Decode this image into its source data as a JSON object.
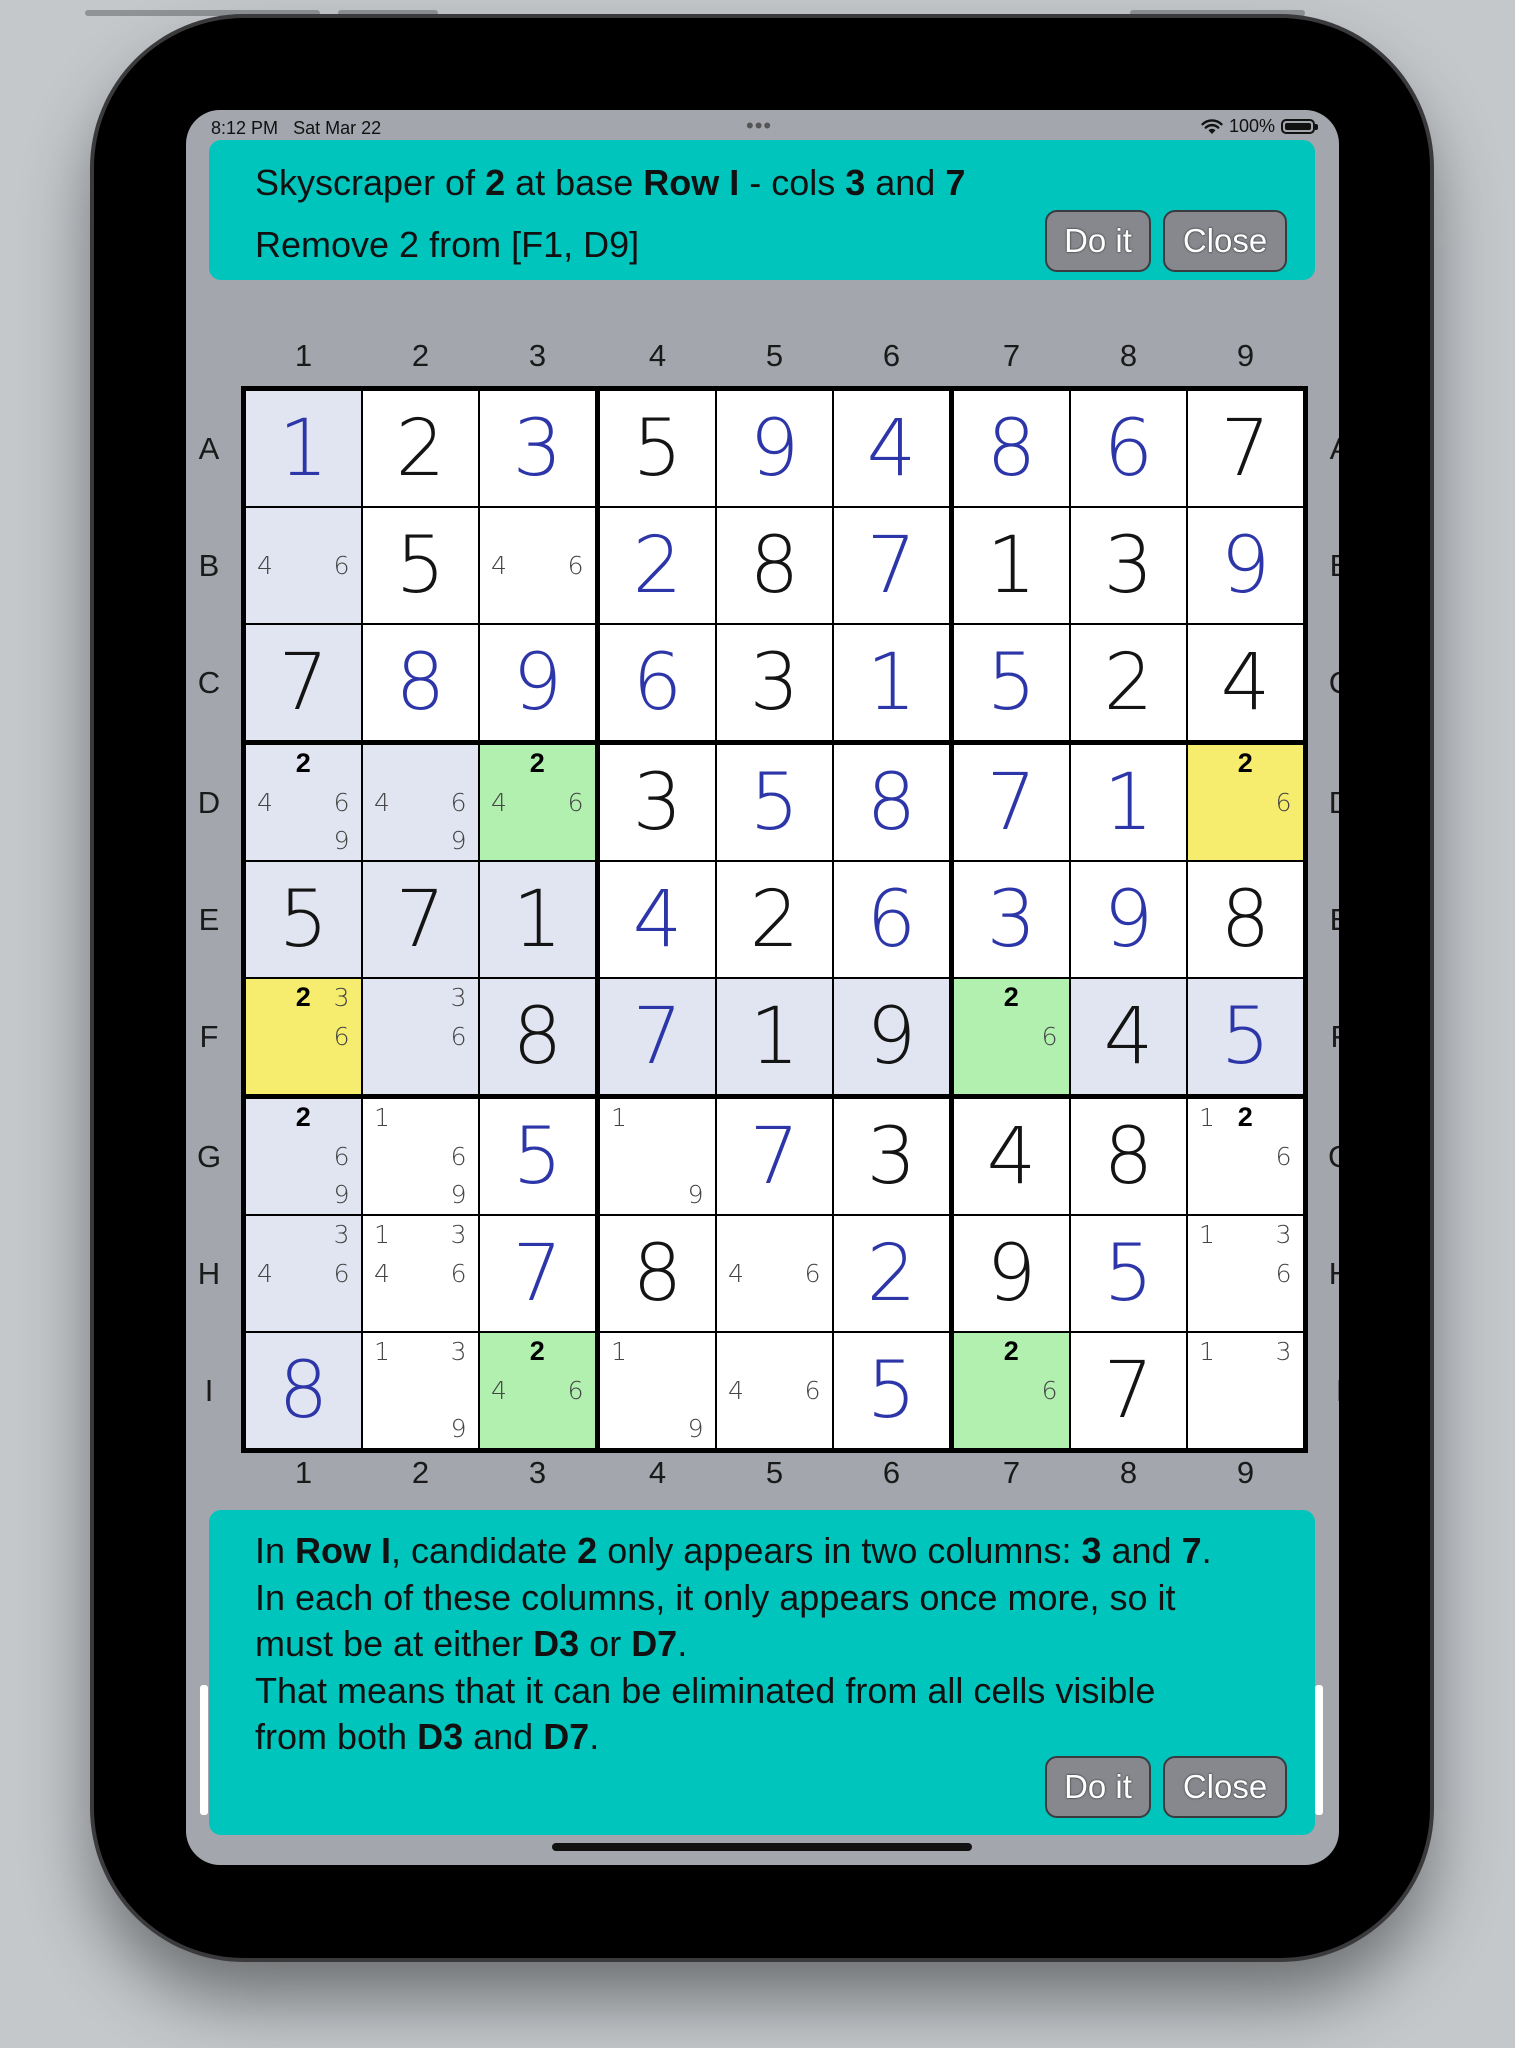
{
  "status_bar": {
    "time": "8:12 PM",
    "date": "Sat Mar 22",
    "battery": "100%"
  },
  "hint_top": {
    "line1": [
      {
        "t": "Skyscraper of ",
        "b": false
      },
      {
        "t": "2",
        "b": true
      },
      {
        "t": " at base ",
        "b": false
      },
      {
        "t": "Row I",
        "b": true
      },
      {
        "t": " - cols ",
        "b": false
      },
      {
        "t": "3",
        "b": true
      },
      {
        "t": " and ",
        "b": false
      },
      {
        "t": "7",
        "b": true
      }
    ],
    "line2": "Remove 2 from [F1, D9]",
    "do_label": "Do it",
    "close_label": "Close"
  },
  "hint_bottom": {
    "lines": [
      [
        {
          "t": "In ",
          "b": false
        },
        {
          "t": "Row I",
          "b": true
        },
        {
          "t": ", candidate ",
          "b": false
        },
        {
          "t": "2",
          "b": true
        },
        {
          "t": " only appears in two columns: ",
          "b": false
        },
        {
          "t": "3",
          "b": true
        },
        {
          "t": " and ",
          "b": false
        },
        {
          "t": "7",
          "b": true
        },
        {
          "t": ".",
          "b": false
        }
      ],
      [
        {
          "t": "In each of these columns, it only appears once more, so it",
          "b": false
        }
      ],
      [
        {
          "t": "must be at either ",
          "b": false
        },
        {
          "t": "D3",
          "b": true
        },
        {
          "t": " or ",
          "b": false
        },
        {
          "t": "D7",
          "b": true
        },
        {
          "t": ".",
          "b": false
        }
      ],
      [
        {
          "t": "That means that it can be eliminated from all cells visible",
          "b": false
        }
      ],
      [
        {
          "t": "from both ",
          "b": false
        },
        {
          "t": "D3",
          "b": true
        },
        {
          "t": " and ",
          "b": false
        },
        {
          "t": "D7",
          "b": true
        },
        {
          "t": ".",
          "b": false
        }
      ]
    ],
    "do_label": "Do it",
    "close_label": "Close"
  },
  "board": {
    "col_labels": [
      "1",
      "2",
      "3",
      "4",
      "5",
      "6",
      "7",
      "8",
      "9"
    ],
    "row_labels": [
      "A",
      "B",
      "C",
      "D",
      "E",
      "F",
      "G",
      "H",
      "I"
    ],
    "colors": {
      "given": "#141414",
      "user": "#2d36a8",
      "highlight": "#e1e5f1",
      "yellow": "#f6ec6e",
      "green": "#b2f0b0"
    },
    "cells": [
      [
        {
          "v": "1",
          "k": "u",
          "bg": "hl"
        },
        {
          "v": "2",
          "k": "g"
        },
        {
          "v": "3",
          "k": "u"
        },
        {
          "v": "5",
          "k": "g"
        },
        {
          "v": "9",
          "k": "u"
        },
        {
          "v": "4",
          "k": "u"
        },
        {
          "v": "8",
          "k": "u"
        },
        {
          "v": "6",
          "k": "u"
        },
        {
          "v": "7",
          "k": "g"
        }
      ],
      [
        {
          "c": [
            4,
            6
          ],
          "bg": "hl"
        },
        {
          "v": "5",
          "k": "g"
        },
        {
          "c": [
            4,
            6
          ]
        },
        {
          "v": "2",
          "k": "u"
        },
        {
          "v": "8",
          "k": "g"
        },
        {
          "v": "7",
          "k": "u"
        },
        {
          "v": "1",
          "k": "g"
        },
        {
          "v": "3",
          "k": "g"
        },
        {
          "v": "9",
          "k": "u"
        }
      ],
      [
        {
          "v": "7",
          "k": "g",
          "bg": "hl"
        },
        {
          "v": "8",
          "k": "u"
        },
        {
          "v": "9",
          "k": "u"
        },
        {
          "v": "6",
          "k": "u"
        },
        {
          "v": "3",
          "k": "g"
        },
        {
          "v": "1",
          "k": "u"
        },
        {
          "v": "5",
          "k": "u"
        },
        {
          "v": "2",
          "k": "g"
        },
        {
          "v": "4",
          "k": "g"
        }
      ],
      [
        {
          "c": [
            2,
            4,
            6,
            9
          ],
          "bg": "hl"
        },
        {
          "c": [
            4,
            6,
            9
          ],
          "bg": "hl"
        },
        {
          "c": [
            2,
            4,
            6
          ],
          "bg": "green"
        },
        {
          "v": "3",
          "k": "g"
        },
        {
          "v": "5",
          "k": "u"
        },
        {
          "v": "8",
          "k": "u"
        },
        {
          "v": "7",
          "k": "u"
        },
        {
          "v": "1",
          "k": "u"
        },
        {
          "c": [
            2,
            6
          ],
          "bg": "yellow"
        }
      ],
      [
        {
          "v": "5",
          "k": "g",
          "bg": "hl"
        },
        {
          "v": "7",
          "k": "g",
          "bg": "hl"
        },
        {
          "v": "1",
          "k": "g",
          "bg": "hl"
        },
        {
          "v": "4",
          "k": "u"
        },
        {
          "v": "2",
          "k": "g"
        },
        {
          "v": "6",
          "k": "u"
        },
        {
          "v": "3",
          "k": "u"
        },
        {
          "v": "9",
          "k": "u"
        },
        {
          "v": "8",
          "k": "g"
        }
      ],
      [
        {
          "c": [
            2,
            3,
            6
          ],
          "bg": "yellow"
        },
        {
          "c": [
            3,
            6
          ],
          "bg": "hl"
        },
        {
          "v": "8",
          "k": "g",
          "bg": "hl"
        },
        {
          "v": "7",
          "k": "u",
          "bg": "hl"
        },
        {
          "v": "1",
          "k": "g",
          "bg": "hl"
        },
        {
          "v": "9",
          "k": "g",
          "bg": "hl"
        },
        {
          "c": [
            2,
            6
          ],
          "bg": "green"
        },
        {
          "v": "4",
          "k": "g",
          "bg": "hl"
        },
        {
          "v": "5",
          "k": "u",
          "bg": "hl"
        }
      ],
      [
        {
          "c": [
            2,
            6,
            9
          ],
          "bg": "hl"
        },
        {
          "c": [
            1,
            6,
            9
          ]
        },
        {
          "v": "5",
          "k": "u"
        },
        {
          "c": [
            1,
            9
          ]
        },
        {
          "v": "7",
          "k": "u"
        },
        {
          "v": "3",
          "k": "g"
        },
        {
          "v": "4",
          "k": "g"
        },
        {
          "v": "8",
          "k": "g"
        },
        {
          "c": [
            1,
            2,
            6
          ]
        }
      ],
      [
        {
          "c": [
            3,
            4,
            6
          ],
          "bg": "hl"
        },
        {
          "c": [
            1,
            3,
            4,
            6
          ]
        },
        {
          "v": "7",
          "k": "u"
        },
        {
          "v": "8",
          "k": "g"
        },
        {
          "c": [
            4,
            6
          ]
        },
        {
          "v": "2",
          "k": "u"
        },
        {
          "v": "9",
          "k": "g"
        },
        {
          "v": "5",
          "k": "u"
        },
        {
          "c": [
            1,
            3,
            6
          ]
        }
      ],
      [
        {
          "v": "8",
          "k": "u",
          "bg": "hl"
        },
        {
          "c": [
            1,
            3,
            9
          ]
        },
        {
          "c": [
            2,
            4,
            6
          ],
          "bg": "green"
        },
        {
          "c": [
            1,
            9
          ]
        },
        {
          "c": [
            4,
            6
          ]
        },
        {
          "v": "5",
          "k": "u"
        },
        {
          "c": [
            2,
            6
          ],
          "bg": "green"
        },
        {
          "v": "7",
          "k": "g"
        },
        {
          "c": [
            1,
            3
          ]
        }
      ]
    ],
    "bold_candidate": 2
  }
}
